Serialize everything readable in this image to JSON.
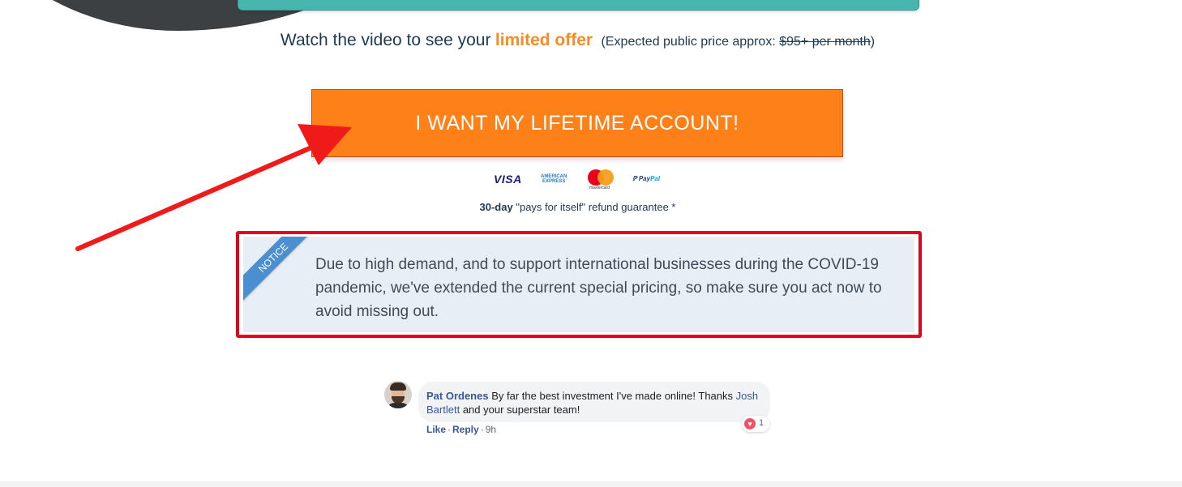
{
  "offer": {
    "watch_text": "Watch the video to see your",
    "highlight": "limited offer",
    "paren_open": "(Expected public price approx: ",
    "old_price": "$95+ per month",
    "paren_close": ")"
  },
  "cta": {
    "label": "I WANT MY LIFETIME ACCOUNT!"
  },
  "payments": {
    "visa": "VISA",
    "amex_line1": "AMERICAN",
    "amex_line2": "EXPRESS",
    "mastercard": "mastercard",
    "paypal_a": "Pay",
    "paypal_b": "Pal"
  },
  "guarantee": {
    "bold": "30-day",
    "rest": "\"pays for itself\" refund guarantee *"
  },
  "notice": {
    "ribbon": "NOTICE",
    "text": "Due to high demand, and to support international businesses during the COVID-19 pandemic, we've extended the current special pricing, so make sure you act now to avoid missing out."
  },
  "comment": {
    "author": "Pat Ordenes",
    "text_part1": "By far the best investment I've made online! Thanks",
    "mention": "Josh Bartlett",
    "text_part2": "and your superstar team!",
    "reaction_count": "1",
    "like": "Like",
    "reply": "Reply",
    "time": "9h",
    "sep": "·"
  },
  "colors": {
    "cta_bg": "#fd8019",
    "highlight": "#f78c23",
    "notice_border": "#e8001a",
    "arrow": "#ef1a1a",
    "ribbon": "#4c8fd1"
  }
}
